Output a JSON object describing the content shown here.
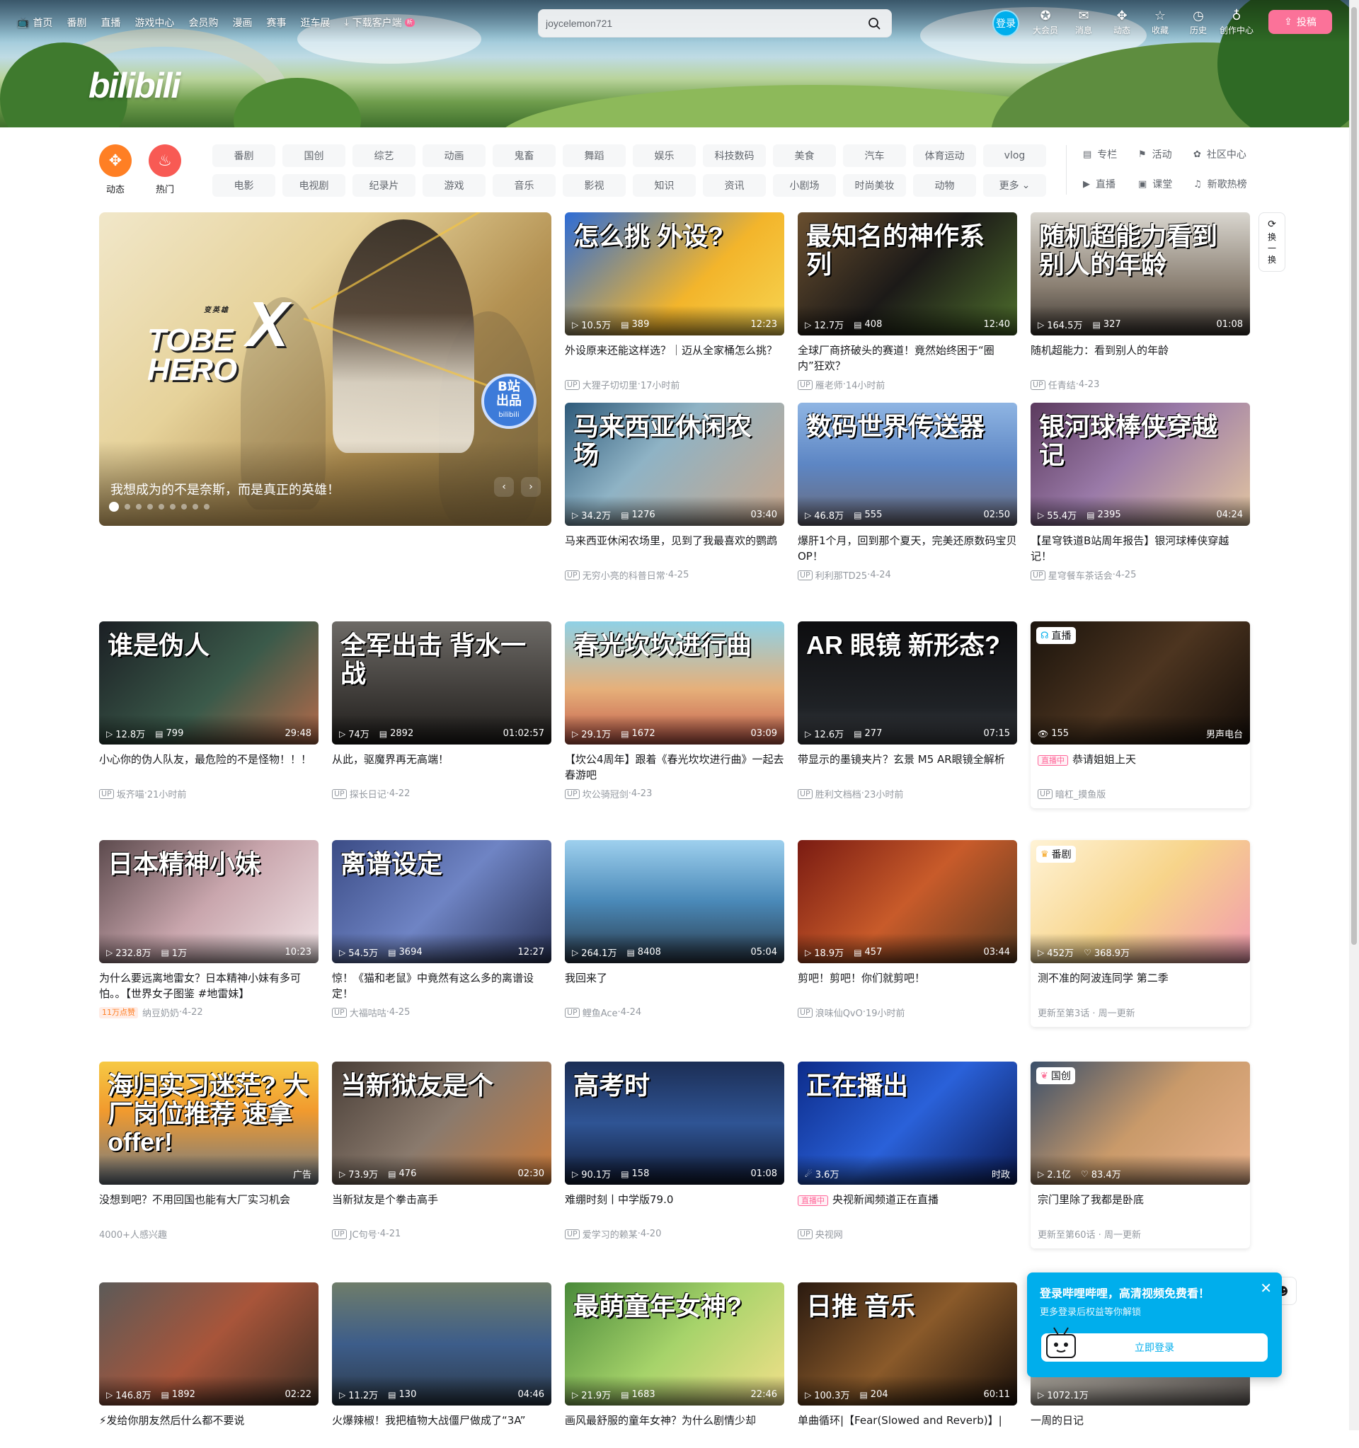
{
  "colors": {
    "brand_pink": "#fb7299",
    "brand_blue": "#00aeec",
    "text_primary": "#18191c",
    "text_secondary": "#9499a0"
  },
  "logo": "bilibili",
  "topnav": {
    "items": [
      {
        "label": "首页",
        "icon": "tv-icon"
      },
      {
        "label": "番剧"
      },
      {
        "label": "直播"
      },
      {
        "label": "游戏中心"
      },
      {
        "label": "会员购"
      },
      {
        "label": "漫画"
      },
      {
        "label": "赛事"
      },
      {
        "label": "逛车展"
      },
      {
        "label": "下载客户端",
        "icon": "download-icon",
        "badge": "新"
      }
    ]
  },
  "search": {
    "value": "joycelemon721"
  },
  "login": {
    "label": "登录"
  },
  "right_nav": [
    {
      "label": "大会员",
      "icon": "vip-icon"
    },
    {
      "label": "消息",
      "icon": "message-icon"
    },
    {
      "label": "动态",
      "icon": "fan-icon"
    },
    {
      "label": "收藏",
      "icon": "star-icon"
    },
    {
      "label": "历史",
      "icon": "clock-icon"
    },
    {
      "label": "创作中心",
      "icon": "bulb-icon"
    }
  ],
  "upload": {
    "label": "投稿"
  },
  "quick": [
    {
      "label": "动态",
      "icon": "fan-icon"
    },
    {
      "label": "热门",
      "icon": "fire-icon"
    }
  ],
  "channels": [
    "番剧",
    "国创",
    "综艺",
    "动画",
    "鬼畜",
    "舞蹈",
    "娱乐",
    "科技数码",
    "美食",
    "汽车",
    "体育运动",
    "vlog",
    "电影",
    "电视剧",
    "纪录片",
    "游戏",
    "音乐",
    "影视",
    "知识",
    "资讯",
    "小剧场",
    "时尚美妆",
    "动物",
    "更多"
  ],
  "right_links": [
    {
      "label": "专栏",
      "icon": "column-icon"
    },
    {
      "label": "活动",
      "icon": "flag-icon"
    },
    {
      "label": "社区中心",
      "icon": "community-icon"
    },
    {
      "label": "直播",
      "icon": "live-icon"
    },
    {
      "label": "课堂",
      "icon": "class-icon"
    },
    {
      "label": "新歌热榜",
      "icon": "music-icon"
    }
  ],
  "carousel": {
    "title": "我想成为的不是奈斯，而是真正的英雄！",
    "logo_small": "变英雄",
    "logo_top": "TOBE",
    "logo_bottom": "HERO",
    "logo_x": "X",
    "stamp": "B站",
    "stamp2": "出品",
    "stamp3": "bilibili",
    "slides": 9,
    "active": 1
  },
  "refresh": {
    "l1": "换",
    "l2": "一",
    "l3": "换"
  },
  "cards": [
    {
      "title": "外设原来还能这样选？｜迈从全家桶怎么挑？",
      "views": "10.5万",
      "danmaku": "389",
      "duration": "12:23",
      "author": "大狸子切切里",
      "date": "17小时前",
      "thumb_text": "怎么挑 外设?",
      "bg": "linear-gradient(135deg,#2d6cd6,#f3b52b 60%,#f6d451)"
    },
    {
      "title": "全球厂商挤破头的赛道！竟然始终困于“圈内”狂欢？",
      "views": "12.7万",
      "danmaku": "408",
      "duration": "12:40",
      "author": "雁老师",
      "date": "14小时前",
      "thumb_text": "最知名的神作系列",
      "bg": "linear-gradient(135deg,#6a4f2f,#1c1a18 50%,#4e6f2c)"
    },
    {
      "title": "随机超能力：看到别人的年龄",
      "views": "164.5万",
      "danmaku": "327",
      "duration": "01:08",
      "author": "任青结",
      "date": "4-23",
      "thumb_text": "随机超能力看到别人的年龄",
      "bg": "linear-gradient(180deg,#d9d6cf,#8a7f72 60%,#3b3530)"
    },
    {
      "title": "马来西亚休闲农场里，见到了我最喜欢的鹦鹉",
      "views": "34.2万",
      "danmaku": "1276",
      "duration": "03:40",
      "author": "无穷小亮的科普日常",
      "date": "4-25",
      "thumb_text": "马来西亚休闲农场",
      "bg": "linear-gradient(135deg,#2e5a7a,#8fb3c5 40%,#c9a68a)"
    },
    {
      "title": "爆肝1个月，回到那个夏天，完美还原数码宝贝OP！",
      "views": "46.8万",
      "danmaku": "555",
      "duration": "02:50",
      "author": "利利那TD25",
      "date": "4-24",
      "thumb_text": "数码世界传送器",
      "bg": "linear-gradient(180deg,#8fb5e3,#5d86c4 50%,#6a6a7a)"
    },
    {
      "title": "【星穹铁道B站周年报告】银河球棒侠穿越记！",
      "views": "55.4万",
      "danmaku": "2395",
      "duration": "04:24",
      "author": "星穹餐车茶话会",
      "date": "4-25",
      "thumb_text": "银河球棒侠穿越记",
      "bg": "linear-gradient(135deg,#5b3a5e,#9a7aa8 45%,#e3c6a0)"
    },
    {
      "title": "小心你的伪人队友，最危险的不是怪物！！！",
      "views": "12.8万",
      "danmaku": "799",
      "duration": "29:48",
      "author": "坂齐喵",
      "date": "21小时前",
      "thumb_text": "谁是伪人",
      "bg": "linear-gradient(135deg,#1b1f24,#3b5a4a 55%,#b56a4a)"
    },
    {
      "title": "从此，驱魔界再无高端！",
      "views": "74万",
      "danmaku": "2892",
      "duration": "01:02:57",
      "author": "探长日记",
      "date": "4-22",
      "thumb_text": "全军出击 背水一战",
      "bg": "linear-gradient(180deg,#6d6a66,#3e3b38 60%,#1e1c1a)"
    },
    {
      "title": "【坎公4周年】跟着《春光坎坎进行曲》一起去春游吧",
      "views": "29.1万",
      "danmaku": "1672",
      "duration": "03:09",
      "author": "坎公骑冠剑",
      "date": "4-23",
      "thumb_text": "春光坎坎进行曲",
      "bg": "linear-gradient(180deg,#8fd1e6,#e6b07a 55%,#c25a4a)"
    },
    {
      "title": "带显示的墨镜夹片？玄景 M5 AR眼镜全解析",
      "views": "12.6万",
      "danmaku": "277",
      "duration": "07:15",
      "author": "胜利文档档",
      "date": "23小时前",
      "thumb_text": "AR 眼镜 新形态?",
      "bg": "linear-gradient(180deg,#0d0d0f,#1f2226 70%,#3c3f44)"
    },
    {
      "title": "恭请姐姐上天",
      "views": "155",
      "author": "暗杠_摸鱼版",
      "live": true,
      "live_label": "直播中",
      "tag": "直播",
      "corner": "男声电台",
      "bg": "linear-gradient(135deg,#1a130c,#4d3520 50%,#120c08)"
    },
    {
      "title": "为什么要远离地雷女？日本精神小妹有多可怕。。【世界女子图鉴 #地雷妹】",
      "views": "232.8万",
      "danmaku": "1万",
      "duration": "10:23",
      "author": "纳豆奶奶",
      "date": "4-22",
      "likes": "11万点赞",
      "thumb_text": "日本精神小妹",
      "bg": "linear-gradient(135deg,#5c4a4d,#c9a6ad 50%,#f1e3e6)"
    },
    {
      "title": "惊！《猫和老鼠》中竟然有这么多的离谱设定！",
      "views": "54.5万",
      "danmaku": "3694",
      "duration": "12:27",
      "author": "大福咕咕",
      "date": "4-25",
      "thumb_text": "离谱设定",
      "bg": "linear-gradient(135deg,#3b4c86,#6f84c4 50%,#2a3459)"
    },
    {
      "title": "我回来了",
      "views": "264.1万",
      "danmaku": "8408",
      "duration": "05:04",
      "author": "鲤鱼Ace",
      "date": "4-24",
      "thumb_text": "",
      "bg": "linear-gradient(180deg,#9ed0ee,#4a89b8 50%,#2b3a4a)"
    },
    {
      "title": "剪吧！剪吧！你们就剪吧！",
      "views": "18.9万",
      "danmaku": "457",
      "duration": "03:44",
      "author": "浪味仙QvO",
      "date": "19小时前",
      "thumb_text": "",
      "bg": "linear-gradient(135deg,#7a1b12,#c85b2a 50%,#5a3a20)"
    },
    {
      "title": "测不准的阿波连同学 第二季",
      "views": "452万",
      "danmaku": "368.9万",
      "author": "",
      "date": "",
      "tag": "番剧",
      "footer": "更新至第3话 · 周一更新",
      "bg": "linear-gradient(135deg,#fff3d6,#f7d48a 50%,#f19ab0)"
    },
    {
      "title": "没想到吧？不用回国也能有大厂实习机会",
      "views": "",
      "danmaku": "",
      "duration": "广告",
      "author": "4000+人感兴趣",
      "date": "",
      "ad": true,
      "thumb_text": "海归实习迷茫? 大厂岗位推荐 速拿 offer!",
      "bg": "linear-gradient(180deg,#f6c944,#f19a2e 40%,#6f7b87)"
    },
    {
      "title": "当新狱友是个拳击高手",
      "views": "73.9万",
      "danmaku": "476",
      "duration": "02:30",
      "author": "JC句号",
      "date": "4-21",
      "thumb_text": "当新狱友是个",
      "bg": "linear-gradient(135deg,#4a3f38,#8a7a6d 50%,#c97a3a)"
    },
    {
      "title": "难绷时刻丨中学版79.0",
      "views": "90.1万",
      "danmaku": "158",
      "duration": "01:08",
      "author": "爱学习的赖某",
      "date": "4-20",
      "thumb_text": "高考时",
      "bg": "linear-gradient(180deg,#1c2e55,#2f5494 50%,#101a33)"
    },
    {
      "title": "央视新闻频道正在直播",
      "views": "3.6万",
      "author": "央视网",
      "live": true,
      "live_label": "直播中",
      "corner": "时政",
      "thumb_text": "正在播出",
      "bg": "linear-gradient(135deg,#0d2c8a,#2a61d9 50%,#0a1a54)"
    },
    {
      "title": "宗门里除了我都是卧底",
      "views": "2.1亿",
      "danmaku": "83.4万",
      "author": "",
      "date": "",
      "tag": "国创",
      "footer": "更新至第60话 · 周一更新",
      "bg": "linear-gradient(135deg,#3a4f6a,#c99a6a 50%,#e8b18a)"
    },
    {
      "title": "⚡发给你朋友然后什么都不要说",
      "views": "146.8万",
      "danmaku": "1892",
      "duration": "02:22",
      "author": "",
      "date": "",
      "thumb_text": "",
      "bg": "linear-gradient(135deg,#5c5a58,#a8553a 50%,#3f2f24)"
    },
    {
      "title": "火爆辣椒！我把植物大战僵尸做成了“3A”",
      "views": "11.2万",
      "danmaku": "130",
      "duration": "04:46",
      "author": "",
      "date": "",
      "thumb_text": "",
      "bg": "linear-gradient(180deg,#6f7d6a,#3d5d8a 50%,#2c3a4a)"
    },
    {
      "title": "画风最舒服的童年女神？为什么剧情少却",
      "views": "21.9万",
      "danmaku": "1683",
      "duration": "22:46",
      "author": "",
      "date": "",
      "thumb_text": "最萌童年女神?",
      "bg": "linear-gradient(135deg,#4a8a3a,#a6d36a 50%,#f3e08a)"
    },
    {
      "title": "单曲循环|【Fear(Slowed and Reverb)】|",
      "views": "100.3万",
      "danmaku": "204",
      "duration": "60:11",
      "author": "",
      "date": "",
      "thumb_text": "日推 音乐",
      "bg": "linear-gradient(135deg,#2a1a10,#8a5a2a 50%,#1a100a)"
    },
    {
      "title": "一周的日记",
      "views": "1072.1万",
      "danmaku": "",
      "duration": "",
      "author": "",
      "date": "",
      "thumb_text": "",
      "bg": "linear-gradient(135deg,#d8d2c4,#a8a29a 50%,#6a6460)"
    }
  ],
  "login_popup": {
    "title": "登录哔哩哔哩，高清视频免费看！",
    "subtitle": "更多登录后权益等你解锁",
    "button": "立即登录"
  }
}
